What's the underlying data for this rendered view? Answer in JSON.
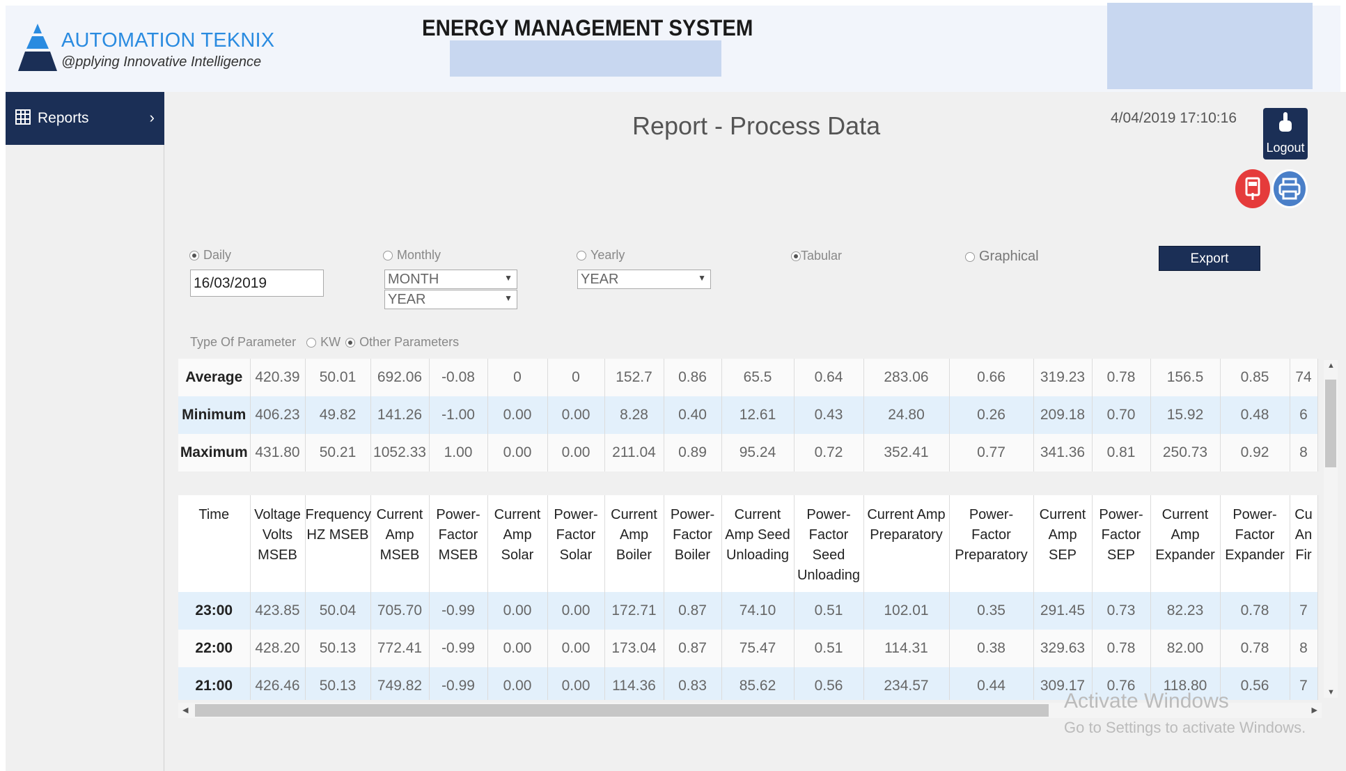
{
  "header": {
    "brand": "AUTOMATION TEKNIX",
    "tagline": "@pplying Innovative Intelligence",
    "system_title": "ENERGY MANAGEMENT SYSTEM"
  },
  "sidebar": {
    "items": [
      {
        "label": "Reports",
        "icon": "grid-icon"
      }
    ]
  },
  "page": {
    "title": "Report - Process Data",
    "datetime": "4/04/2019 17:10:16",
    "logout_label": "Logout"
  },
  "filters": {
    "daily_label": "Daily",
    "monthly_label": "Monthly",
    "yearly_label": "Yearly",
    "tabular_label": "Tabular",
    "graphical_label": "Graphical",
    "date_value": "16/03/2019",
    "month_select": "MONTH",
    "year_select_monthly": "YEAR",
    "year_select_yearly": "YEAR",
    "export_label": "Export",
    "type_param_label": "Type Of Parameter",
    "kw_label": "KW",
    "other_label": "Other Parameters"
  },
  "summary": {
    "rows": [
      {
        "label": "Average",
        "values": [
          "420.39",
          "50.01",
          "692.06",
          "-0.08",
          "0",
          "0",
          "152.7",
          "0.86",
          "65.5",
          "0.64",
          "283.06",
          "0.66",
          "319.23",
          "0.78",
          "156.5",
          "0.85",
          "74"
        ]
      },
      {
        "label": "Minimum",
        "values": [
          "406.23",
          "49.82",
          "141.26",
          "-1.00",
          "0.00",
          "0.00",
          "8.28",
          "0.40",
          "12.61",
          "0.43",
          "24.80",
          "0.26",
          "209.18",
          "0.70",
          "15.92",
          "0.48",
          "6"
        ]
      },
      {
        "label": "Maximum",
        "values": [
          "431.80",
          "50.21",
          "1052.33",
          "1.00",
          "0.00",
          "0.00",
          "211.04",
          "0.89",
          "95.24",
          "0.72",
          "352.41",
          "0.77",
          "341.36",
          "0.81",
          "250.73",
          "0.92",
          "8"
        ]
      }
    ]
  },
  "table": {
    "columns": [
      "Time",
      "Voltage Volts MSEB",
      "Frequency HZ MSEB",
      "Current Amp MSEB",
      "Power-Factor MSEB",
      "Current Amp Solar",
      "Power-Factor Solar",
      "Current Amp Boiler",
      "Power-Factor Boiler",
      "Current Amp Seed Unloading",
      "Power-Factor Seed Unloading",
      "Current Amp Preparatory",
      "Power-Factor Preparatory",
      "Current Amp SEP",
      "Power-Factor SEP",
      "Current Amp Expander",
      "Power-Factor Expander",
      "Cu An Fir"
    ],
    "rows": [
      {
        "time": "23:00",
        "values": [
          "423.85",
          "50.04",
          "705.70",
          "-0.99",
          "0.00",
          "0.00",
          "172.71",
          "0.87",
          "74.10",
          "0.51",
          "102.01",
          "0.35",
          "291.45",
          "0.73",
          "82.23",
          "0.78",
          "7"
        ]
      },
      {
        "time": "22:00",
        "values": [
          "428.20",
          "50.13",
          "772.41",
          "-0.99",
          "0.00",
          "0.00",
          "173.04",
          "0.87",
          "75.47",
          "0.51",
          "114.31",
          "0.38",
          "329.63",
          "0.78",
          "82.00",
          "0.78",
          "8"
        ]
      },
      {
        "time": "21:00",
        "values": [
          "426.46",
          "50.13",
          "749.82",
          "-0.99",
          "0.00",
          "0.00",
          "114.36",
          "0.83",
          "85.62",
          "0.56",
          "234.57",
          "0.44",
          "309.17",
          "0.76",
          "118.80",
          "0.56",
          "7"
        ]
      }
    ]
  },
  "watermark": {
    "line1": "Activate Windows",
    "line2": "Go to Settings to activate Windows."
  },
  "colors": {
    "navy": "#1b2f56",
    "brand_blue": "#2a8be0",
    "row_alt": "#e3f0fb",
    "pdf_red": "#e53b3b",
    "print_blue": "#4a7fc8"
  }
}
